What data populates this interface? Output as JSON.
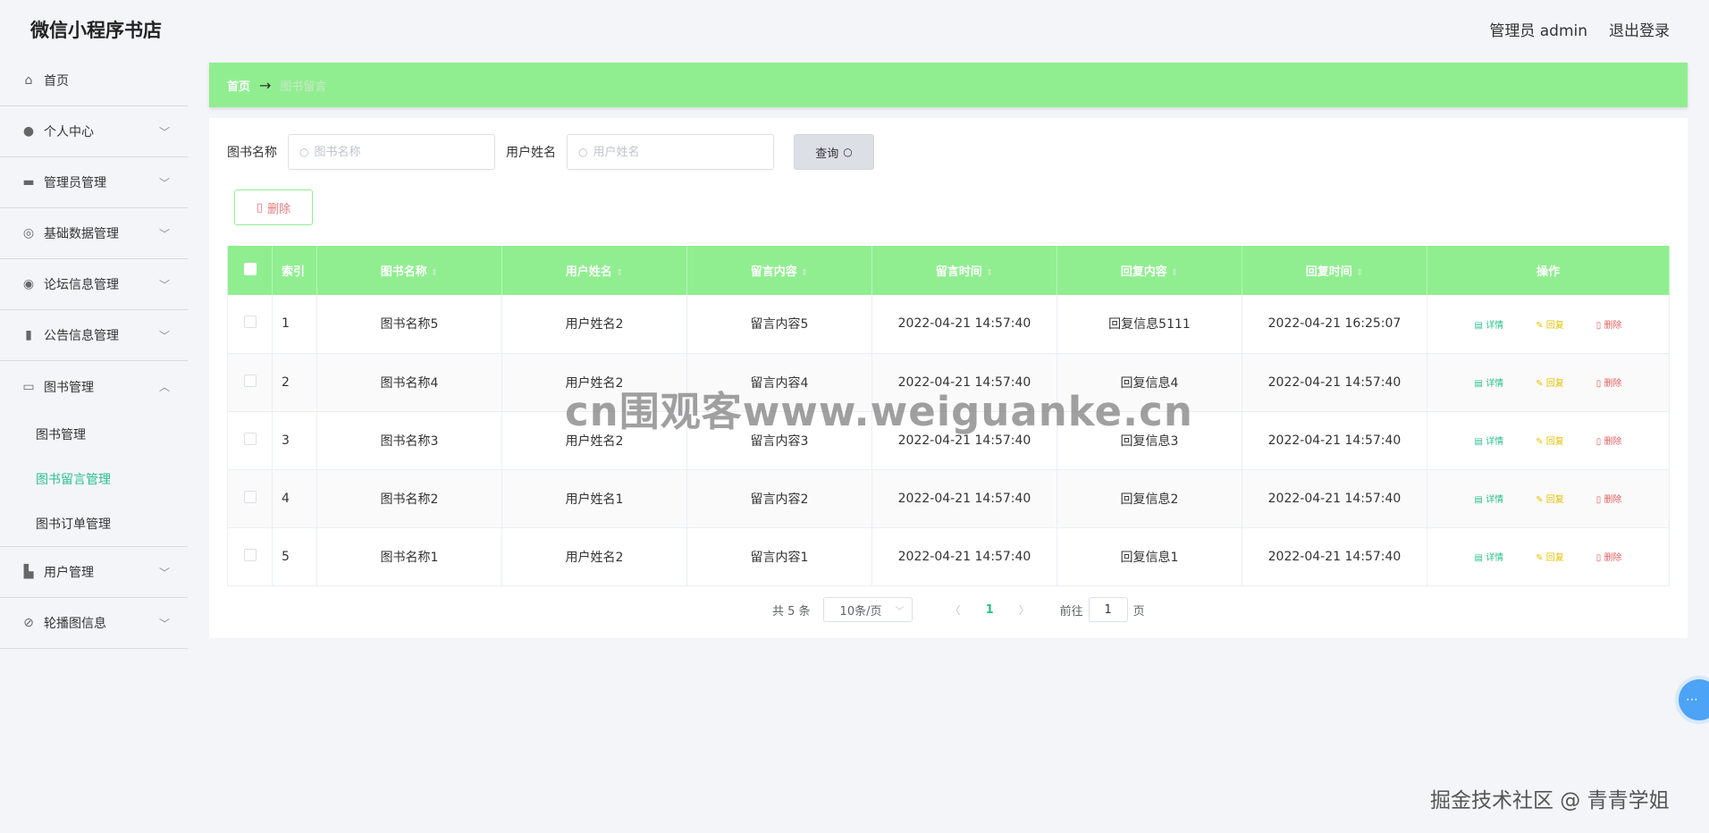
{
  "app": {
    "title": "微信小程序书店"
  },
  "header": {
    "user_label": "管理员 admin",
    "logout_label": "退出登录"
  },
  "sidebar": {
    "items": [
      {
        "label": "首页",
        "icon": "home-icon",
        "has_chevron": false
      },
      {
        "label": "个人中心",
        "icon": "user-icon",
        "has_chevron": true
      },
      {
        "label": "管理员管理",
        "icon": "briefcase-icon",
        "has_chevron": true
      },
      {
        "label": "基础数据管理",
        "icon": "aperture-icon",
        "has_chevron": true
      },
      {
        "label": "论坛信息管理",
        "icon": "target-icon",
        "has_chevron": true
      },
      {
        "label": "公告信息管理",
        "icon": "clipboard-icon",
        "has_chevron": true
      },
      {
        "label": "图书管理",
        "icon": "book-icon",
        "has_chevron": true,
        "expanded": true
      },
      {
        "label": "用户管理",
        "icon": "users-icon",
        "has_chevron": true
      },
      {
        "label": "轮播图信息",
        "icon": "compass-icon",
        "has_chevron": true
      }
    ],
    "submenu": [
      {
        "label": "图书管理",
        "active": false
      },
      {
        "label": "图书留言管理",
        "active": true
      },
      {
        "label": "图书订单管理",
        "active": false
      }
    ]
  },
  "breadcrumb": {
    "home": "首页",
    "arrow": "→",
    "current": "图书留言"
  },
  "search": {
    "book_label": "图书名称",
    "book_placeholder": "图书名称",
    "user_label": "用户姓名",
    "user_placeholder": "用户姓名",
    "query_label": "查询"
  },
  "toolbar": {
    "delete_label": "删除"
  },
  "table": {
    "columns": [
      "索引",
      "图书名称",
      "用户姓名",
      "留言内容",
      "留言时间",
      "回复内容",
      "回复时间",
      "操作"
    ],
    "rows": [
      {
        "index": "1",
        "book": "图书名称5",
        "user": "用户姓名2",
        "content": "留言内容5",
        "time": "2022-04-21 14:57:40",
        "reply": "回复信息5111",
        "reply_time": "2022-04-21 16:25:07"
      },
      {
        "index": "2",
        "book": "图书名称4",
        "user": "用户姓名2",
        "content": "留言内容4",
        "time": "2022-04-21 14:57:40",
        "reply": "回复信息4",
        "reply_time": "2022-04-21 14:57:40"
      },
      {
        "index": "3",
        "book": "图书名称3",
        "user": "用户姓名2",
        "content": "留言内容3",
        "time": "2022-04-21 14:57:40",
        "reply": "回复信息3",
        "reply_time": "2022-04-21 14:57:40"
      },
      {
        "index": "4",
        "book": "图书名称2",
        "user": "用户姓名1",
        "content": "留言内容2",
        "time": "2022-04-21 14:57:40",
        "reply": "回复信息2",
        "reply_time": "2022-04-21 14:57:40"
      },
      {
        "index": "5",
        "book": "图书名称1",
        "user": "用户姓名2",
        "content": "留言内容1",
        "time": "2022-04-21 14:57:40",
        "reply": "回复信息1",
        "reply_time": "2022-04-21 14:57:40"
      }
    ],
    "ops": {
      "detail": "详情",
      "reply": "回复",
      "delete": "删除"
    }
  },
  "pager": {
    "total": "共 5 条",
    "page_size": "10条/页",
    "current": "1",
    "goto_label": "前往",
    "goto_value": "1",
    "page_suffix": "页"
  },
  "watermark": {
    "text": "cn围观客www.weiguanke.cn",
    "footer": "掘金技术社区 @ 青青学姐"
  },
  "colors": {
    "accent_green": "#90ee90",
    "active_text": "#2bbf8e",
    "reply_yellow": "#e6c000",
    "delete_red": "#e26060"
  }
}
